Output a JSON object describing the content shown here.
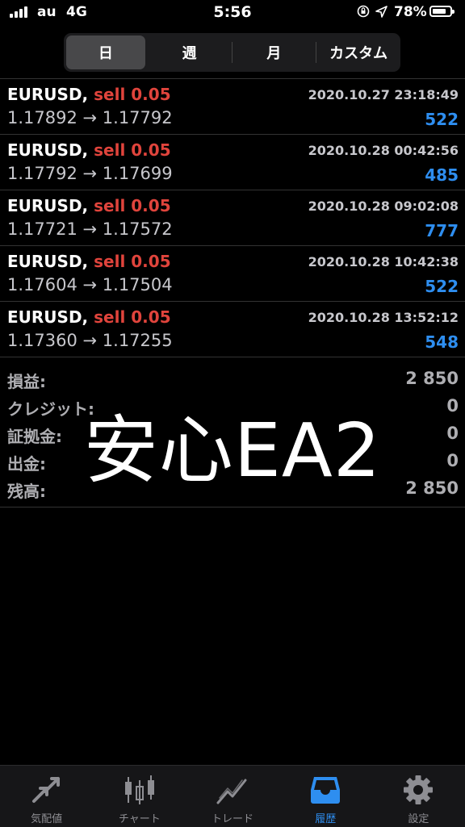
{
  "status_bar": {
    "carrier": "au",
    "network": "4G",
    "time": "5:56",
    "battery": "78%"
  },
  "segments": [
    "日",
    "週",
    "月",
    "カスタム"
  ],
  "trades": [
    {
      "symbol": "EURUSD,",
      "side": "sell 0.05",
      "datetime": "2020.10.27 23:18:49",
      "prices": "1.17892 → 1.17792",
      "profit": "522"
    },
    {
      "symbol": "EURUSD,",
      "side": "sell 0.05",
      "datetime": "2020.10.28 00:42:56",
      "prices": "1.17792 → 1.17699",
      "profit": "485"
    },
    {
      "symbol": "EURUSD,",
      "side": "sell 0.05",
      "datetime": "2020.10.28 09:02:08",
      "prices": "1.17721 → 1.17572",
      "profit": "777"
    },
    {
      "symbol": "EURUSD,",
      "side": "sell 0.05",
      "datetime": "2020.10.28 10:42:38",
      "prices": "1.17604 → 1.17504",
      "profit": "522"
    },
    {
      "symbol": "EURUSD,",
      "side": "sell 0.05",
      "datetime": "2020.10.28 13:52:12",
      "prices": "1.17360 → 1.17255",
      "profit": "548"
    }
  ],
  "summary": [
    {
      "label": "損益:",
      "value": "2 850"
    },
    {
      "label": "クレジット:",
      "value": "0"
    },
    {
      "label": "証拠金:",
      "value": "0"
    },
    {
      "label": "出金:",
      "value": "0"
    },
    {
      "label": "残高:",
      "value": "2 850"
    }
  ],
  "watermark": "安心EA2",
  "tabs": [
    {
      "label": "気配値",
      "icon": "quotes-arrows-icon"
    },
    {
      "label": "チャート",
      "icon": "candlestick-chart-icon"
    },
    {
      "label": "トレード",
      "icon": "trade-line-icon"
    },
    {
      "label": "履歴",
      "icon": "history-inbox-icon"
    },
    {
      "label": "設定",
      "icon": "settings-gear-icon"
    }
  ],
  "colors": {
    "sell": "#e0443c",
    "profit": "#2e8ef0",
    "active_tab": "#2e8ef0"
  }
}
